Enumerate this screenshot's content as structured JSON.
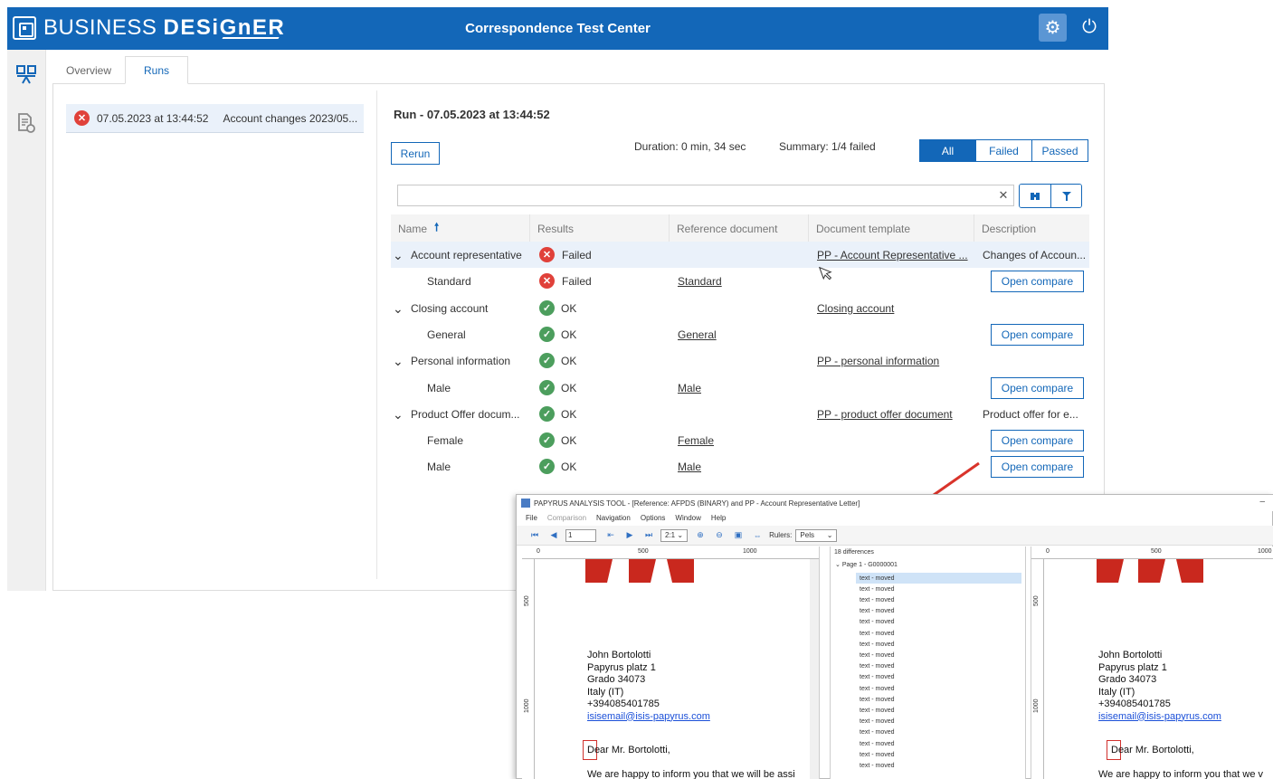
{
  "app": {
    "brand_light": "BUSINESS ",
    "brand_bold": "DESiGnER",
    "title": "Correspondence Test Center"
  },
  "tabs": {
    "overview": "Overview",
    "runs": "Runs"
  },
  "runs_list": [
    {
      "date": "07.05.2023 at 13:44:52",
      "name": "Account changes 2023/05...",
      "status": "failed"
    }
  ],
  "run": {
    "title": "Run - 07.05.2023 at 13:44:52",
    "rerun_label": "Rerun",
    "duration": "Duration:  0 min, 34 sec",
    "summary": "Summary: 1/4 failed",
    "filters": {
      "all": "All",
      "failed": "Failed",
      "passed": "Passed"
    },
    "search_value": ""
  },
  "table": {
    "headers": {
      "name": "Name",
      "results": "Results",
      "reference": "Reference document",
      "template": "Document template",
      "description": "Description"
    },
    "open_compare_label": "Open compare",
    "rows": [
      {
        "name": "Account representative",
        "level": 0,
        "result": "Failed",
        "status": "failed",
        "reference": "",
        "template": "PP - Account Representative ...",
        "description": "Changes of Accoun...",
        "compare": false,
        "selected": true
      },
      {
        "name": "Standard",
        "level": 1,
        "result": "Failed",
        "status": "failed",
        "reference": "Standard",
        "template": "",
        "description": "",
        "compare": true
      },
      {
        "name": "Closing account",
        "level": 0,
        "result": "OK",
        "status": "ok",
        "reference": "",
        "template": "Closing account",
        "description": "",
        "compare": false
      },
      {
        "name": "General",
        "level": 1,
        "result": "OK",
        "status": "ok",
        "reference": "General",
        "template": "",
        "description": "",
        "compare": true
      },
      {
        "name": "Personal information",
        "level": 0,
        "result": "OK",
        "status": "ok",
        "reference": "",
        "template": "PP - personal information",
        "description": "",
        "compare": false
      },
      {
        "name": "Male",
        "level": 1,
        "result": "OK",
        "status": "ok",
        "reference": "Male",
        "template": "",
        "description": "",
        "compare": true
      },
      {
        "name": "Product Offer docum...",
        "level": 0,
        "result": "OK",
        "status": "ok",
        "reference": "",
        "template": "PP - product offer document",
        "description": "Product offer for e...",
        "compare": false
      },
      {
        "name": "Female",
        "level": 1,
        "result": "OK",
        "status": "ok",
        "reference": "Female",
        "template": "",
        "description": "",
        "compare": true
      },
      {
        "name": "Male",
        "level": 1,
        "result": "OK",
        "status": "ok",
        "reference": "Male",
        "template": "",
        "description": "",
        "compare": true
      }
    ]
  },
  "analysis_tool": {
    "title": "PAPYRUS ANALYSIS TOOL - [Reference: AFPDS (BINARY) and PP - Account Representative Letter]",
    "menu": [
      "File",
      "Comparison",
      "Navigation",
      "Options",
      "Window",
      "Help"
    ],
    "page_input": "1",
    "zoom": "2:1",
    "rulers_label": "Rulers:",
    "rulers_value": "Pels",
    "ruler_ticks": [
      "0",
      "500",
      "1000"
    ],
    "ruler_v_ticks": [
      "500",
      "1000"
    ],
    "diff_count": "18  differences",
    "diff_page": "Page 1 - G0000001",
    "diff_items": [
      "text - moved",
      "text - moved",
      "text - moved",
      "text - moved",
      "text - moved",
      "text - moved",
      "text - moved",
      "text - moved",
      "text - moved",
      "text - moved",
      "text - moved",
      "text - moved",
      "text - moved",
      "text - moved",
      "text - moved",
      "text - moved",
      "text - moved",
      "text - moved"
    ],
    "letter_left": {
      "lines": [
        "John Bortolotti",
        "Papyrus platz 1",
        "Grado 34073",
        "Italy (IT)",
        "+394085401785"
      ],
      "email": "isisemail@isis-papyrus.com",
      "salutation": "Dear Mr. Bortolotti,",
      "body": "We are happy to inform you that we will be assi"
    },
    "letter_right": {
      "lines": [
        "John Bortolotti",
        "Papyrus platz 1",
        "Grado 34073",
        "Italy (IT)",
        "+394085401785"
      ],
      "email": "isisemail@isis-papyrus.com",
      "salutation": "Dear Mr. Bortolotti,",
      "body": "We are happy to inform you that we v"
    }
  },
  "colors": {
    "brand_blue": "#1367b8",
    "error_red": "#e0413a",
    "ok_green": "#4c9e5d",
    "annotation_arrow": "#d9342b"
  },
  "icons": [
    "workspace-icon",
    "document-settings-icon",
    "gear-icon",
    "power-icon",
    "error-icon",
    "check-icon",
    "clear-icon",
    "binoculars-icon",
    "filter-icon",
    "chevron-down-icon",
    "sort-up-icon"
  ]
}
